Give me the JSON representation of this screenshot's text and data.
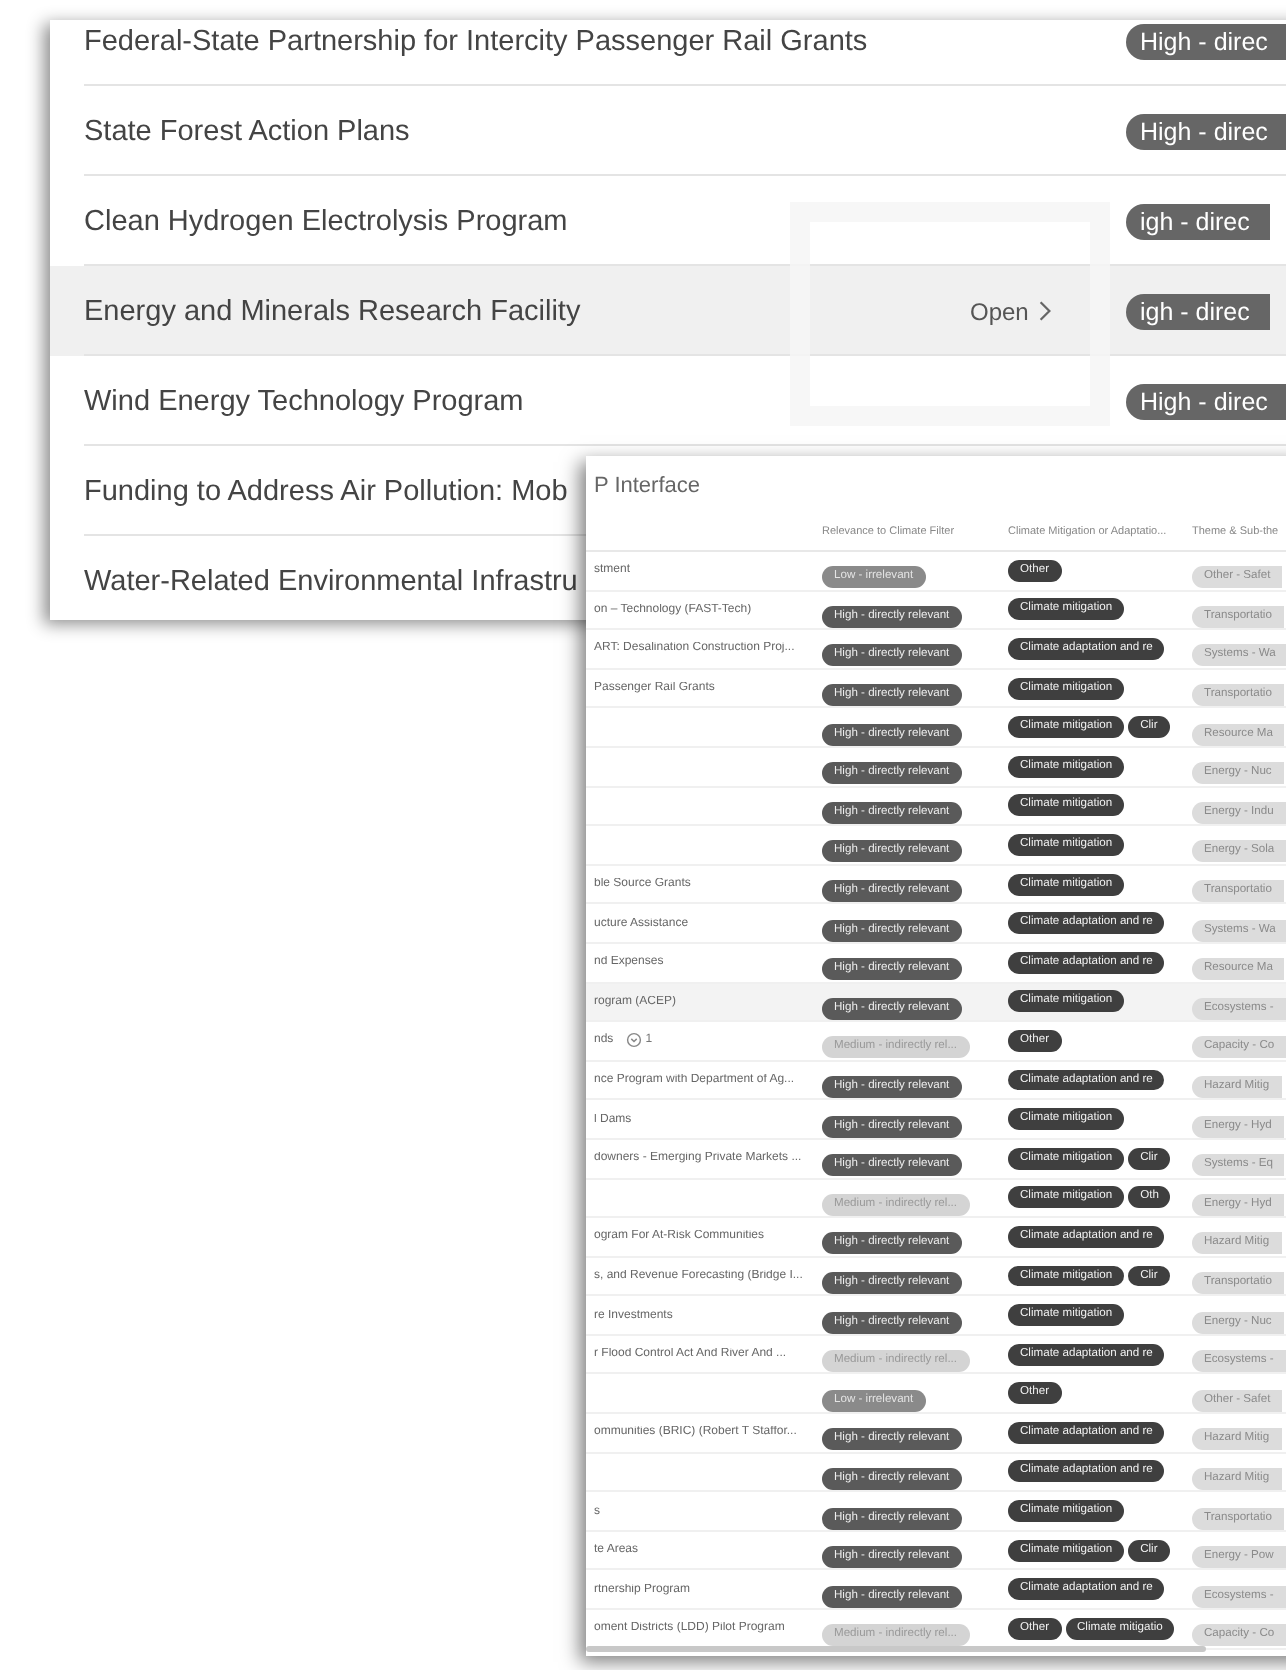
{
  "list_panel": {
    "rows": [
      {
        "name": "Federal-State Partnership for Intercity Passenger Rail Grants",
        "badge": "High - direc",
        "selected": false
      },
      {
        "name": "State Forest Action Plans",
        "badge": "High - direc",
        "selected": false
      },
      {
        "name": "Clean Hydrogen Electrolysis Program",
        "badge": "igh - direc",
        "selected": false
      },
      {
        "name": "Energy and Minerals Research Facility",
        "badge": "igh - direc",
        "selected": true,
        "action": "Open"
      },
      {
        "name": "Wind Energy Technology Program",
        "badge": "High - direc",
        "selected": false
      },
      {
        "name": "Funding to Address Air Pollution: Mob",
        "selected": false
      },
      {
        "name": "Water-Related Environmental Infrastru",
        "selected": false
      }
    ]
  },
  "table_panel": {
    "title": "P Interface",
    "columns": [
      "Relevance to Climate Filter",
      "Climate Mitigation or Adaptatio...",
      "Theme & Sub-the"
    ],
    "rows": [
      {
        "name": "stment",
        "relevance": {
          "kind": "low",
          "text": "Low - irrelevant"
        },
        "tags": [
          "Other"
        ],
        "theme": "Other - Safet",
        "selected": false
      },
      {
        "name": "on – Technology (FAST-Tech)",
        "relevance": {
          "kind": "high",
          "text": "High - directly relevant"
        },
        "tags": [
          "Climate mitigation"
        ],
        "theme": "Transportatio",
        "selected": false
      },
      {
        "name": "ART: Desalination Construction Proj...",
        "relevance": {
          "kind": "high",
          "text": "High - directly relevant"
        },
        "tags": [
          "Climate adaptation and re"
        ],
        "theme": "Systems - Wa",
        "selected": false
      },
      {
        "name": "Passenger Rail Grants",
        "relevance": {
          "kind": "high",
          "text": "High - directly relevant"
        },
        "tags": [
          "Climate mitigation"
        ],
        "theme": "Transportatio",
        "selected": false
      },
      {
        "relevance": {
          "kind": "high",
          "text": "High - directly relevant"
        },
        "tags": [
          "Climate mitigation",
          "Clir"
        ],
        "theme": "Resource Ma",
        "selected": false
      },
      {
        "relevance": {
          "kind": "high",
          "text": "High - directly relevant"
        },
        "tags": [
          "Climate mitigation"
        ],
        "theme": "Energy - Nuc",
        "selected": false
      },
      {
        "relevance": {
          "kind": "high",
          "text": "High - directly relevant"
        },
        "tags": [
          "Climate mitigation"
        ],
        "theme": "Energy - Indu",
        "selected": false
      },
      {
        "relevance": {
          "kind": "high",
          "text": "High - directly relevant"
        },
        "tags": [
          "Climate mitigation"
        ],
        "theme": "Energy - Sola",
        "selected": false
      },
      {
        "name": "ble Source Grants",
        "relevance": {
          "kind": "high",
          "text": "High - directly relevant"
        },
        "tags": [
          "Climate mitigation"
        ],
        "theme": "Transportatio",
        "selected": false
      },
      {
        "name": "ucture Assistance",
        "relevance": {
          "kind": "high",
          "text": "High - directly relevant"
        },
        "tags": [
          "Climate adaptation and re"
        ],
        "theme": "Systems - Wa",
        "selected": false
      },
      {
        "name": "nd Expenses",
        "relevance": {
          "kind": "high",
          "text": "High - directly relevant"
        },
        "tags": [
          "Climate adaptation and re"
        ],
        "theme": "Resource Ma",
        "selected": false
      },
      {
        "name": "rogram (ACEP)",
        "relevance": {
          "kind": "high",
          "text": "High - directly relevant"
        },
        "tags": [
          "Climate mitigation"
        ],
        "theme": "Ecosystems -",
        "selected": true
      },
      {
        "name": "nds",
        "comments": "1",
        "relevance": {
          "kind": "medium",
          "text": "Medium - indirectly rel..."
        },
        "tags": [
          "Other"
        ],
        "theme": "Capacity - Co",
        "selected": false
      },
      {
        "name": "nce Program with Department of Ag...",
        "relevance": {
          "kind": "high",
          "text": "High - directly relevant"
        },
        "tags": [
          "Climate adaptation and re"
        ],
        "theme": "Hazard Mitig",
        "selected": false
      },
      {
        "name": "l Dams",
        "relevance": {
          "kind": "high",
          "text": "High - directly relevant"
        },
        "tags": [
          "Climate mitigation"
        ],
        "theme": "Energy - Hyd",
        "selected": false
      },
      {
        "name": "downers - Emerging Private Markets ...",
        "relevance": {
          "kind": "high",
          "text": "High - directly relevant"
        },
        "tags": [
          "Climate mitigation",
          "Clir"
        ],
        "theme": "Systems - Eq",
        "selected": false
      },
      {
        "relevance": {
          "kind": "medium",
          "text": "Medium - indirectly rel..."
        },
        "tags": [
          "Climate mitigation",
          "Oth"
        ],
        "theme": "Energy - Hyd",
        "selected": false
      },
      {
        "name": "ogram For At-Risk Communities",
        "relevance": {
          "kind": "high",
          "text": "High - directly relevant"
        },
        "tags": [
          "Climate adaptation and re"
        ],
        "theme": "Hazard Mitig",
        "selected": false
      },
      {
        "name": "s, and Revenue Forecasting (Bridge I...",
        "relevance": {
          "kind": "high",
          "text": "High - directly relevant"
        },
        "tags": [
          "Climate mitigation",
          "Clir"
        ],
        "theme": "Transportatio",
        "selected": false
      },
      {
        "name": "re Investments",
        "relevance": {
          "kind": "high",
          "text": "High - directly relevant"
        },
        "tags": [
          "Climate mitigation"
        ],
        "theme": "Energy - Nuc",
        "selected": false
      },
      {
        "name": "r Flood Control Act And River And ...",
        "relevance": {
          "kind": "medium",
          "text": "Medium - indirectly rel..."
        },
        "tags": [
          "Climate adaptation and re"
        ],
        "theme": "Ecosystems -",
        "selected": false
      },
      {
        "relevance": {
          "kind": "low",
          "text": "Low - irrelevant"
        },
        "tags": [
          "Other"
        ],
        "theme": "Other - Safet",
        "selected": false
      },
      {
        "name": "ommunities (BRIC) (Robert T Staffor...",
        "relevance": {
          "kind": "high",
          "text": "High - directly relevant"
        },
        "tags": [
          "Climate adaptation and re"
        ],
        "theme": "Hazard Mitig",
        "selected": false
      },
      {
        "relevance": {
          "kind": "high",
          "text": "High - directly relevant"
        },
        "tags": [
          "Climate adaptation and re"
        ],
        "theme": "Hazard Mitig",
        "selected": false
      },
      {
        "name": "s",
        "relevance": {
          "kind": "high",
          "text": "High - directly relevant"
        },
        "tags": [
          "Climate mitigation"
        ],
        "theme": "Transportatio",
        "selected": false
      },
      {
        "name": "te Areas",
        "relevance": {
          "kind": "high",
          "text": "High - directly relevant"
        },
        "tags": [
          "Climate mitigation",
          "Clir"
        ],
        "theme": "Energy - Pow",
        "selected": false
      },
      {
        "name": "rtnership Program",
        "relevance": {
          "kind": "high",
          "text": "High - directly relevant"
        },
        "tags": [
          "Climate adaptation and re"
        ],
        "theme": "Ecosystems -",
        "selected": false
      },
      {
        "name": "oment Districts (LDD) Pilot Program",
        "relevance": {
          "kind": "medium",
          "text": "Medium - indirectly rel..."
        },
        "tags": [
          "Other",
          "Climate mitigatio"
        ],
        "theme": "Capacity - Co",
        "selected": false
      }
    ]
  }
}
